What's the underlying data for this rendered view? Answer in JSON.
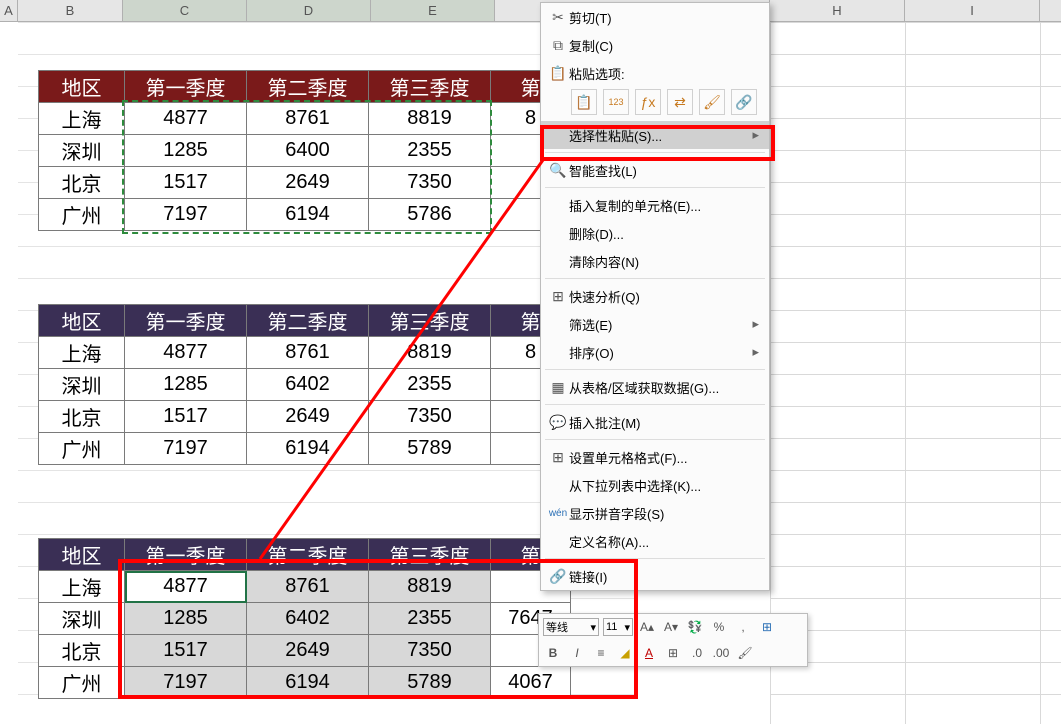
{
  "columns": {
    "A": "A",
    "B": "B",
    "C": "C",
    "D": "D",
    "E": "E",
    "H": "H",
    "I": "I"
  },
  "table_headers": {
    "region": "地区",
    "q1": "第一季度",
    "q2": "第二季度",
    "q3": "第三季度",
    "q4": "第"
  },
  "table1_rows": [
    {
      "region": "上海",
      "q1": "4877",
      "q2": "8761",
      "q3": "8819",
      "q4": "8"
    },
    {
      "region": "深圳",
      "q1": "1285",
      "q2": "6400",
      "q3": "2355",
      "q4": ""
    },
    {
      "region": "北京",
      "q1": "1517",
      "q2": "2649",
      "q3": "7350",
      "q4": ""
    },
    {
      "region": "广州",
      "q1": "7197",
      "q2": "6194",
      "q3": "5786",
      "q4": ""
    }
  ],
  "table2_rows": [
    {
      "region": "上海",
      "q1": "4877",
      "q2": "8761",
      "q3": "8819",
      "q4": "8"
    },
    {
      "region": "深圳",
      "q1": "1285",
      "q2": "6402",
      "q3": "2355",
      "q4": ""
    },
    {
      "region": "北京",
      "q1": "1517",
      "q2": "2649",
      "q3": "7350",
      "q4": ""
    },
    {
      "region": "广州",
      "q1": "7197",
      "q2": "6194",
      "q3": "5789",
      "q4": ""
    }
  ],
  "table3_rows": [
    {
      "region": "上海",
      "q1": "4877",
      "q2": "8761",
      "q3": "8819",
      "q4": ""
    },
    {
      "region": "深圳",
      "q1": "1285",
      "q2": "6402",
      "q3": "2355",
      "q4": "7647"
    },
    {
      "region": "北京",
      "q1": "1517",
      "q2": "2649",
      "q3": "7350",
      "q4": ""
    },
    {
      "region": "广州",
      "q1": "7197",
      "q2": "6194",
      "q3": "5789",
      "q4": "4067"
    }
  ],
  "context_menu": {
    "cut": "剪切(T)",
    "copy": "复制(C)",
    "paste_options_label": "粘贴选项:",
    "paste_special": "选择性粘贴(S)...",
    "smart_lookup": "智能查找(L)",
    "insert_copied": "插入复制的单元格(E)...",
    "delete": "删除(D)...",
    "clear": "清除内容(N)",
    "quick_analysis": "快速分析(Q)",
    "filter": "筛选(E)",
    "sort": "排序(O)",
    "get_data": "从表格/区域获取数据(G)...",
    "insert_comment": "插入批注(M)",
    "format_cells": "设置单元格格式(F)...",
    "pick_from_list": "从下拉列表中选择(K)...",
    "phonetic": "显示拼音字段(S)",
    "define_name": "定义名称(A)...",
    "link": "链接(I)"
  },
  "mini_toolbar": {
    "font_name": "等线",
    "font_size": "11"
  }
}
